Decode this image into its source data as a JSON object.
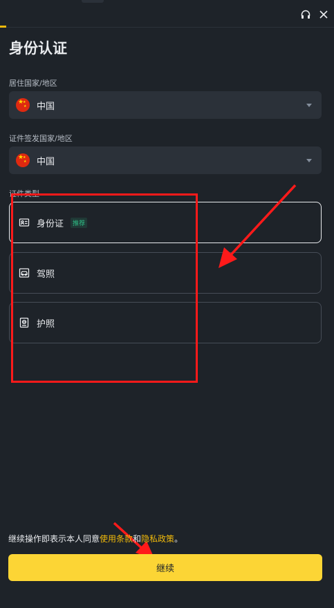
{
  "header": {
    "support_icon": "headset-icon",
    "close_icon": "close-icon"
  },
  "page": {
    "title": "身份认证"
  },
  "residence": {
    "label": "居住国家/地区",
    "value": "中国",
    "flag_icon": "china-flag-icon"
  },
  "issuing": {
    "label": "证件签发国家/地区",
    "value": "中国",
    "flag_icon": "china-flag-icon"
  },
  "document_type": {
    "label": "证件类型",
    "options": [
      {
        "label": "身份证",
        "badge": "推荐",
        "icon": "id-card-icon",
        "selected": true
      },
      {
        "label": "驾照",
        "icon": "drivers-license-icon",
        "selected": false
      },
      {
        "label": "护照",
        "icon": "passport-icon",
        "selected": false
      }
    ]
  },
  "agreement": {
    "prefix": "继续操作即表示本人同意",
    "terms_link": "使用条款",
    "conjunction": "和",
    "privacy_link": "隐私政策",
    "suffix": "。"
  },
  "actions": {
    "continue_label": "继续"
  },
  "colors": {
    "background": "#1e2329",
    "accent": "#fcd535",
    "link": "#f0b90b",
    "annotation": "#ff1a1a",
    "recommend": "#2ebd85"
  }
}
